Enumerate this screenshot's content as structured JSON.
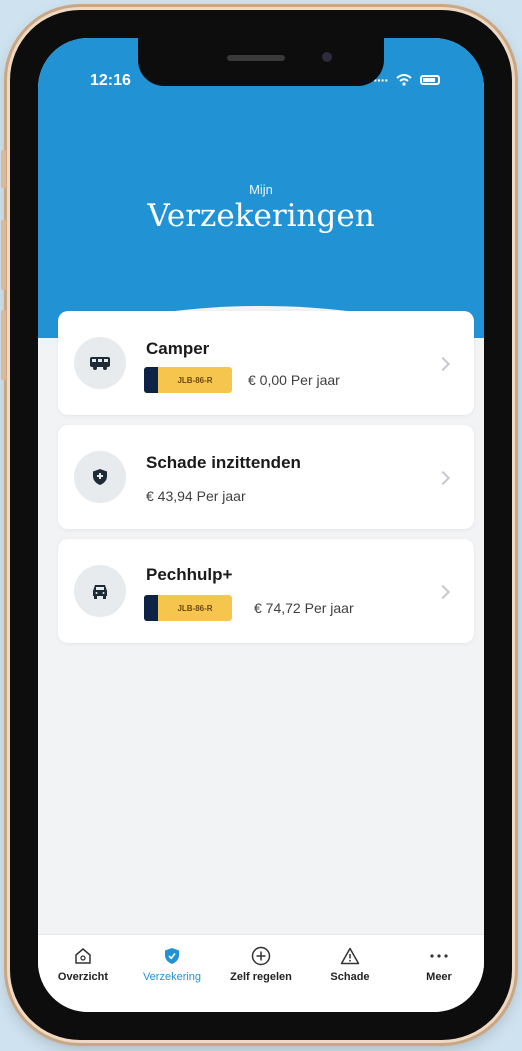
{
  "status_bar": {
    "time": "12:16"
  },
  "header": {
    "subtitle": "Mijn",
    "title": "Verzekeringen"
  },
  "policies": [
    {
      "title": "Camper",
      "plate": "JLB-86-R",
      "price": "€ 0,00 Per jaar",
      "icon": "camper-icon"
    },
    {
      "title": "Schade inzittenden",
      "price": "€ 43,94 Per jaar",
      "icon": "shield-icon"
    },
    {
      "title": "Pechhulp+",
      "plate": "JLB-86-R",
      "price": "€ 74,72 Per jaar",
      "icon": "car-icon"
    }
  ],
  "tabbar": {
    "active": "Verzekering",
    "items": [
      {
        "label": "Overzicht",
        "icon": "home-icon"
      },
      {
        "label": "Verzekering",
        "icon": "shield-icon"
      },
      {
        "label": "Zelf regelen",
        "icon": "plus-circle-icon"
      },
      {
        "label": "Schade",
        "icon": "warning-icon"
      },
      {
        "label": "Meer",
        "icon": "more-icon"
      }
    ]
  },
  "colors": {
    "primary": "#2193d5",
    "plate": "#f6c54d",
    "plate_strip": "#0c2246",
    "background": "#f2f3f5"
  }
}
